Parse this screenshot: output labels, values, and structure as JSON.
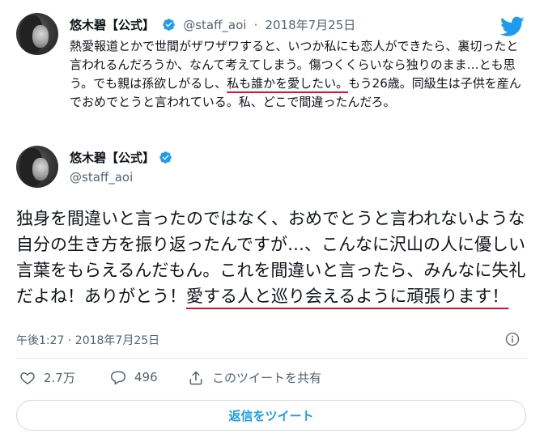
{
  "tweet_quoted": {
    "name": "悠木碧【公式】",
    "handle": "@staff_aoi",
    "separator": "·",
    "date": "2018年7月25日",
    "text_part1": "熱愛報道とかで世間がザワザワすると、いつか私にも恋人ができたら、裏切ったと言われるんだろうか、なんて考えてしまう。傷つくくらいなら独りのまま…とも思う。でも親は孫欲しがるし、",
    "text_highlight": "私も誰かを愛したい。",
    "text_part2": "もう26歳。同級生は子供を産んでおめでとうと言われている。私、どこで間違ったんだろ。"
  },
  "tweet_main": {
    "name": "悠木碧【公式】",
    "handle": "@staff_aoi",
    "text_part1": "独身を間違いと言ったのではなく、おめでとうと言われないような自分の生き方を振り返ったんですが…、こんなに沢山の人に優しい言葉をもらえるんだもん。これを間違いと言ったら、みんなに失礼だよね！ありがとう！",
    "text_highlight": "愛する人と巡り会えるように頑張ります！",
    "timestamp": "午後1:27 · 2018年7月25日",
    "likes": "2.7万",
    "replies": "496",
    "share_label": "このツイートを共有",
    "reply_button": "返信をツイート"
  },
  "icons": [
    "verified-icon",
    "twitter-logo-icon",
    "info-icon",
    "heart-icon",
    "reply-icon",
    "share-icon"
  ],
  "colors": {
    "accent": "#1d9bf0",
    "highlight_underline": "#e0102c",
    "muted": "#536471"
  }
}
